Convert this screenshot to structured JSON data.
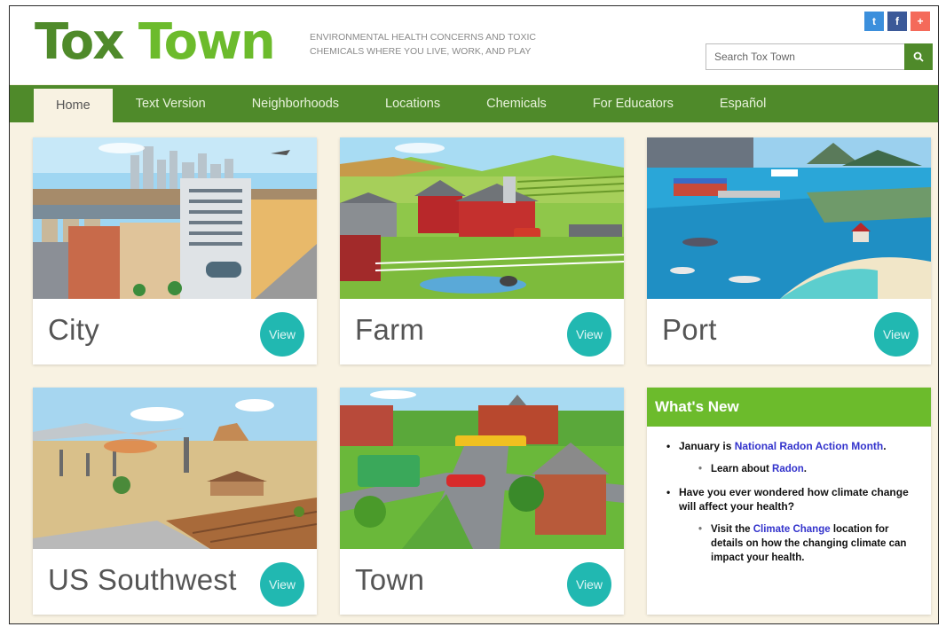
{
  "header": {
    "logo_part1": "Tox",
    "logo_part2": "Town",
    "tagline": "Environmental health concerns and toxic chemicals where you live, work, and play",
    "search_placeholder": "Search Tox Town",
    "social": [
      {
        "icon": "twitter-icon",
        "glyph": "t"
      },
      {
        "icon": "facebook-icon",
        "glyph": "f"
      },
      {
        "icon": "share-plus-icon",
        "glyph": "+"
      }
    ]
  },
  "nav": {
    "items": [
      "Home",
      "Text Version",
      "Neighborhoods",
      "Locations",
      "Chemicals",
      "For Educators",
      "Español"
    ],
    "active": "Home"
  },
  "cards": [
    {
      "title": "City",
      "view": "View"
    },
    {
      "title": "Farm",
      "view": "View"
    },
    {
      "title": "Port",
      "view": "View"
    },
    {
      "title": "US Southwest",
      "view": "View"
    },
    {
      "title": "Town",
      "view": "View"
    }
  ],
  "whats_new": {
    "heading": "What's New",
    "item1_pre": "January is ",
    "item1_link": "National Radon Action Month",
    "item1_post": ".",
    "item1_sub_pre": "Learn about ",
    "item1_sub_link": "Radon",
    "item1_sub_post": ".",
    "item2": "Have you ever wondered how climate change will affect your health?",
    "item2_sub_pre": "Visit the ",
    "item2_sub_link": "Climate Change",
    "item2_sub_post": " location for details on how the changing climate can impact your health."
  },
  "colors": {
    "brand_dark_green": "#4f8a2a",
    "brand_light_green": "#6cbb2c",
    "view_teal": "#21b8b1",
    "background_cream": "#f8f2e2",
    "link_blue": "#3333cc"
  }
}
